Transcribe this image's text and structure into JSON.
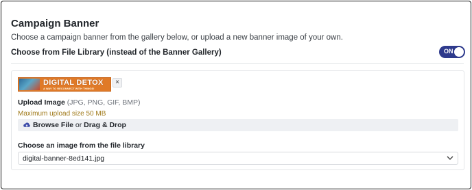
{
  "section": {
    "title": "Campaign Banner",
    "description": "Choose a campaign banner from the gallery below, or upload a new banner image of your own."
  },
  "library_toggle": {
    "label": "Choose from File Library (instead of the Banner Gallery)",
    "state_text": "ON",
    "is_on": true,
    "color": "#2e3a8c"
  },
  "banner_preview": {
    "title": "DIGITAL DETOX",
    "subtitle": "A WAY TO RECONNECT WITH THINGS!",
    "remove_icon": "close-icon",
    "remove_glyph": "×",
    "bg_color": "#e07a28"
  },
  "upload": {
    "label": "Upload Image",
    "types": "(JPG, PNG, GIF, BMP)",
    "max_size": "Maximum upload size 50 MB",
    "browse_label": "Browse File",
    "or_text": "or",
    "drag_label": "Drag & Drop",
    "icon": "cloud-upload-icon"
  },
  "file_library": {
    "label": "Choose an image from the file library",
    "selected_value": "digital-banner-8ed141.jpg",
    "icon": "chevron-down-icon"
  }
}
